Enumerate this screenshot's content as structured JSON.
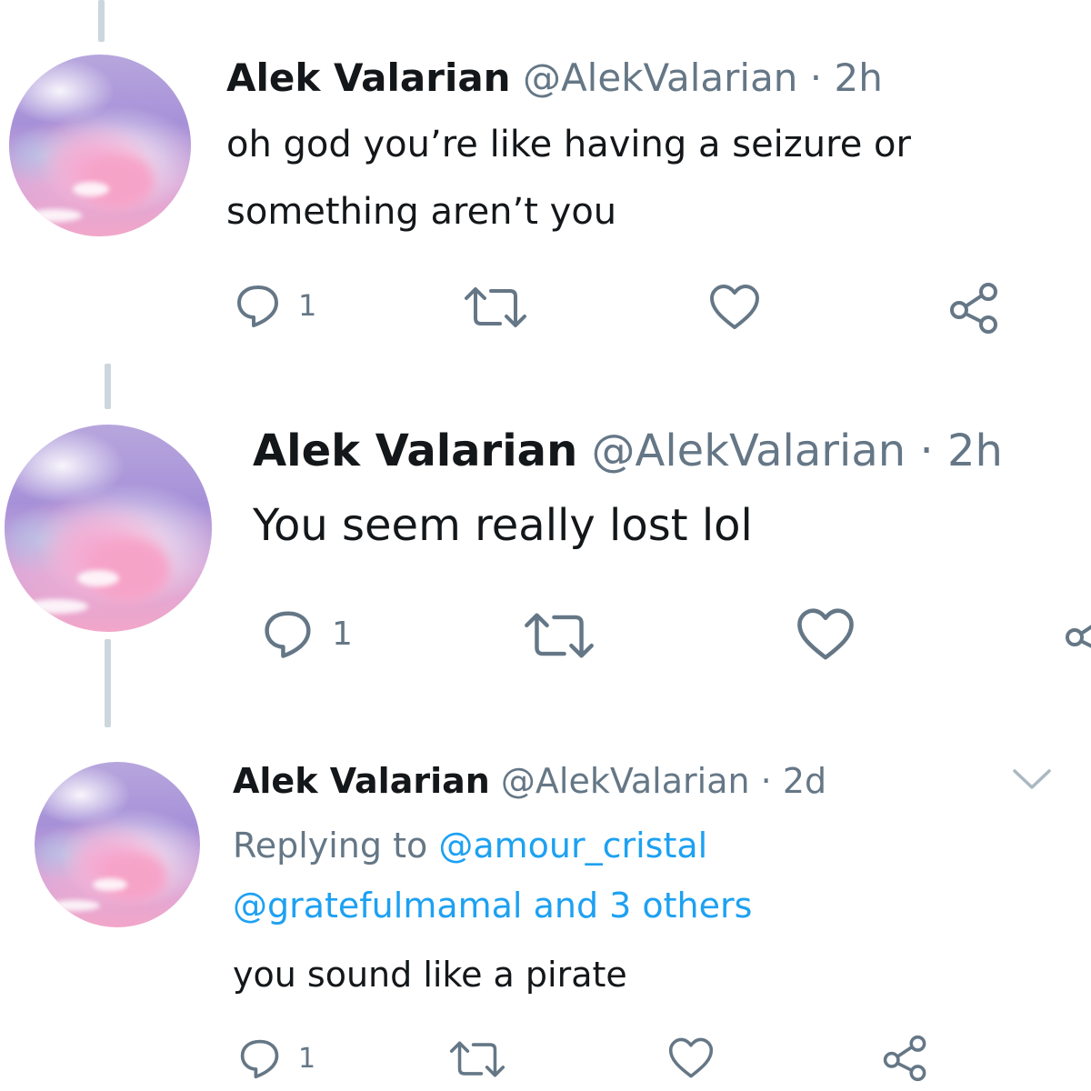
{
  "tweets": [
    {
      "name": "Alek Valarian",
      "handle": "@AlekValarian",
      "separator": "·",
      "time": "2h",
      "text_lines": [
        "oh god you’re like having a seizure or",
        "something aren’t you"
      ],
      "reply_count": "1"
    },
    {
      "name": "Alek Valarian",
      "handle": "@AlekValarian",
      "separator": "·",
      "time": "2h",
      "text_lines": [
        "You seem really lost lol"
      ],
      "reply_count": "1"
    },
    {
      "name": "Alek Valarian",
      "handle": "@AlekValarian",
      "separator": "·",
      "time": "2d",
      "replying_prefix": "Replying to",
      "replying_user": "@amour_cristal",
      "replying_more": "@gratefulmamal and 3 others",
      "text_lines": [
        "you sound like a pirate"
      ],
      "reply_count": "1"
    }
  ],
  "icons": {
    "reply": "speech-bubble-icon",
    "retweet": "retweet-icon",
    "like": "heart-icon",
    "share": "share-icon",
    "menu": "chevron-down-icon"
  },
  "colors": {
    "text": "#14171a",
    "secondary": "#657786",
    "link": "#1da1f2",
    "thread_line": "#ccd6dd"
  }
}
